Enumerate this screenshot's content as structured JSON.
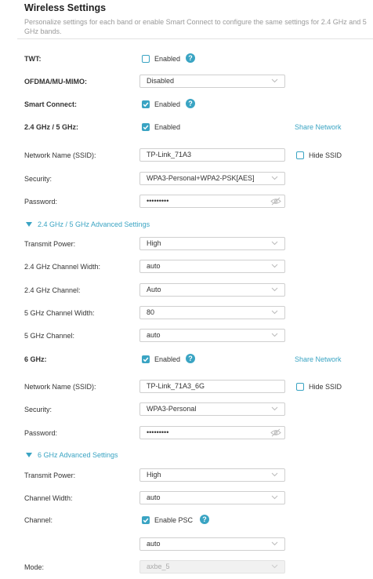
{
  "header": {
    "title": "Wireless Settings",
    "description": "Personalize settings for each band or enable Smart Connect to configure the same settings for 2.4 GHz and 5 GHz bands."
  },
  "twt": {
    "label": "TWT:",
    "checked": false,
    "option": "Enabled"
  },
  "ofdma": {
    "label": "OFDMA/MU-MIMO:",
    "value": "Disabled"
  },
  "smart_connect": {
    "label": "Smart Connect:",
    "checked": true,
    "option": "Enabled"
  },
  "band24_5": {
    "label": "2.4 GHz / 5 GHz:",
    "checked": true,
    "option": "Enabled",
    "share_network": "Share Network",
    "ssid_label": "Network Name (SSID):",
    "ssid_value": "TP-Link_71A3",
    "hide_ssid": "Hide SSID",
    "security_label": "Security:",
    "security_value": "WPA3-Personal+WPA2-PSK[AES]",
    "password_label": "Password:",
    "password_value": "•••••••••",
    "advanced_title": "2.4 GHz / 5 GHz Advanced Settings",
    "advanced": [
      {
        "label": "Transmit Power:",
        "value": "High"
      },
      {
        "label": "2.4 GHz Channel Width:",
        "value": "auto"
      },
      {
        "label": "2.4 GHz Channel:",
        "value": "Auto"
      },
      {
        "label": "5 GHz Channel Width:",
        "value": "80"
      },
      {
        "label": "5 GHz Channel:",
        "value": "auto"
      }
    ]
  },
  "band6": {
    "label": "6 GHz:",
    "checked": true,
    "option": "Enabled",
    "share_network": "Share Network",
    "ssid_label": "Network Name (SSID):",
    "ssid_value": "TP-Link_71A3_6G",
    "hide_ssid": "Hide SSID",
    "security_label": "Security:",
    "security_value": "WPA3-Personal",
    "password_label": "Password:",
    "password_value": "•••••••••",
    "advanced_title": "6 GHz Advanced Settings",
    "transmit_power_label": "Transmit Power:",
    "transmit_power_value": "High",
    "channel_width_label": "Channel Width:",
    "channel_width_value": "auto",
    "channel_label": "Channel:",
    "enable_psc": "Enable PSC",
    "channel_value": "auto",
    "mode_label": "Mode:",
    "mode_value": "axbe_5"
  },
  "colors": {
    "accent": "#3aa4c3",
    "help": "#3aa4c3"
  }
}
